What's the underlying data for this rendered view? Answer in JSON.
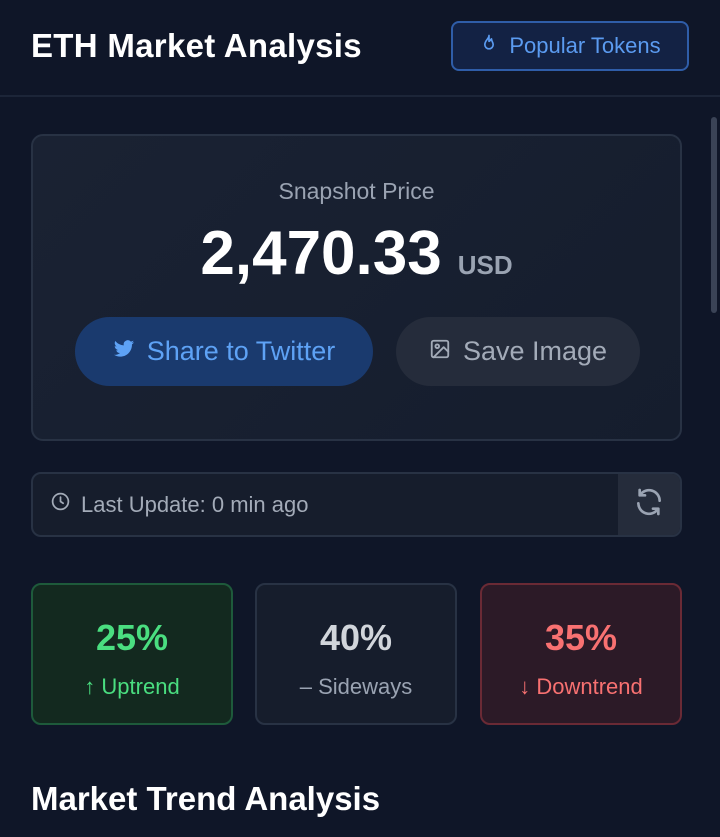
{
  "header": {
    "title": "ETH Market Analysis",
    "popular_button_label": "Popular Tokens"
  },
  "snapshot": {
    "label": "Snapshot Price",
    "price": "2,470.33",
    "unit": "USD",
    "share_label": "Share to Twitter",
    "save_label": "Save Image"
  },
  "update": {
    "text": "Last Update: 0 min ago"
  },
  "trends": {
    "up": {
      "pct": "25%",
      "label": "↑ Uptrend"
    },
    "sideways": {
      "pct": "40%",
      "label": "– Sideways"
    },
    "down": {
      "pct": "35%",
      "label": "↓ Downtrend"
    }
  },
  "section": {
    "title": "Market Trend Analysis"
  },
  "colors": {
    "background": "#0f1628",
    "accent_blue": "#5b9bf0",
    "uptrend_green": "#4ade80",
    "downtrend_red": "#f87171"
  },
  "icons": {
    "popular": "flame-icon",
    "share": "twitter-icon",
    "save": "image-icon",
    "update": "clock-icon",
    "refresh": "refresh-icon"
  }
}
